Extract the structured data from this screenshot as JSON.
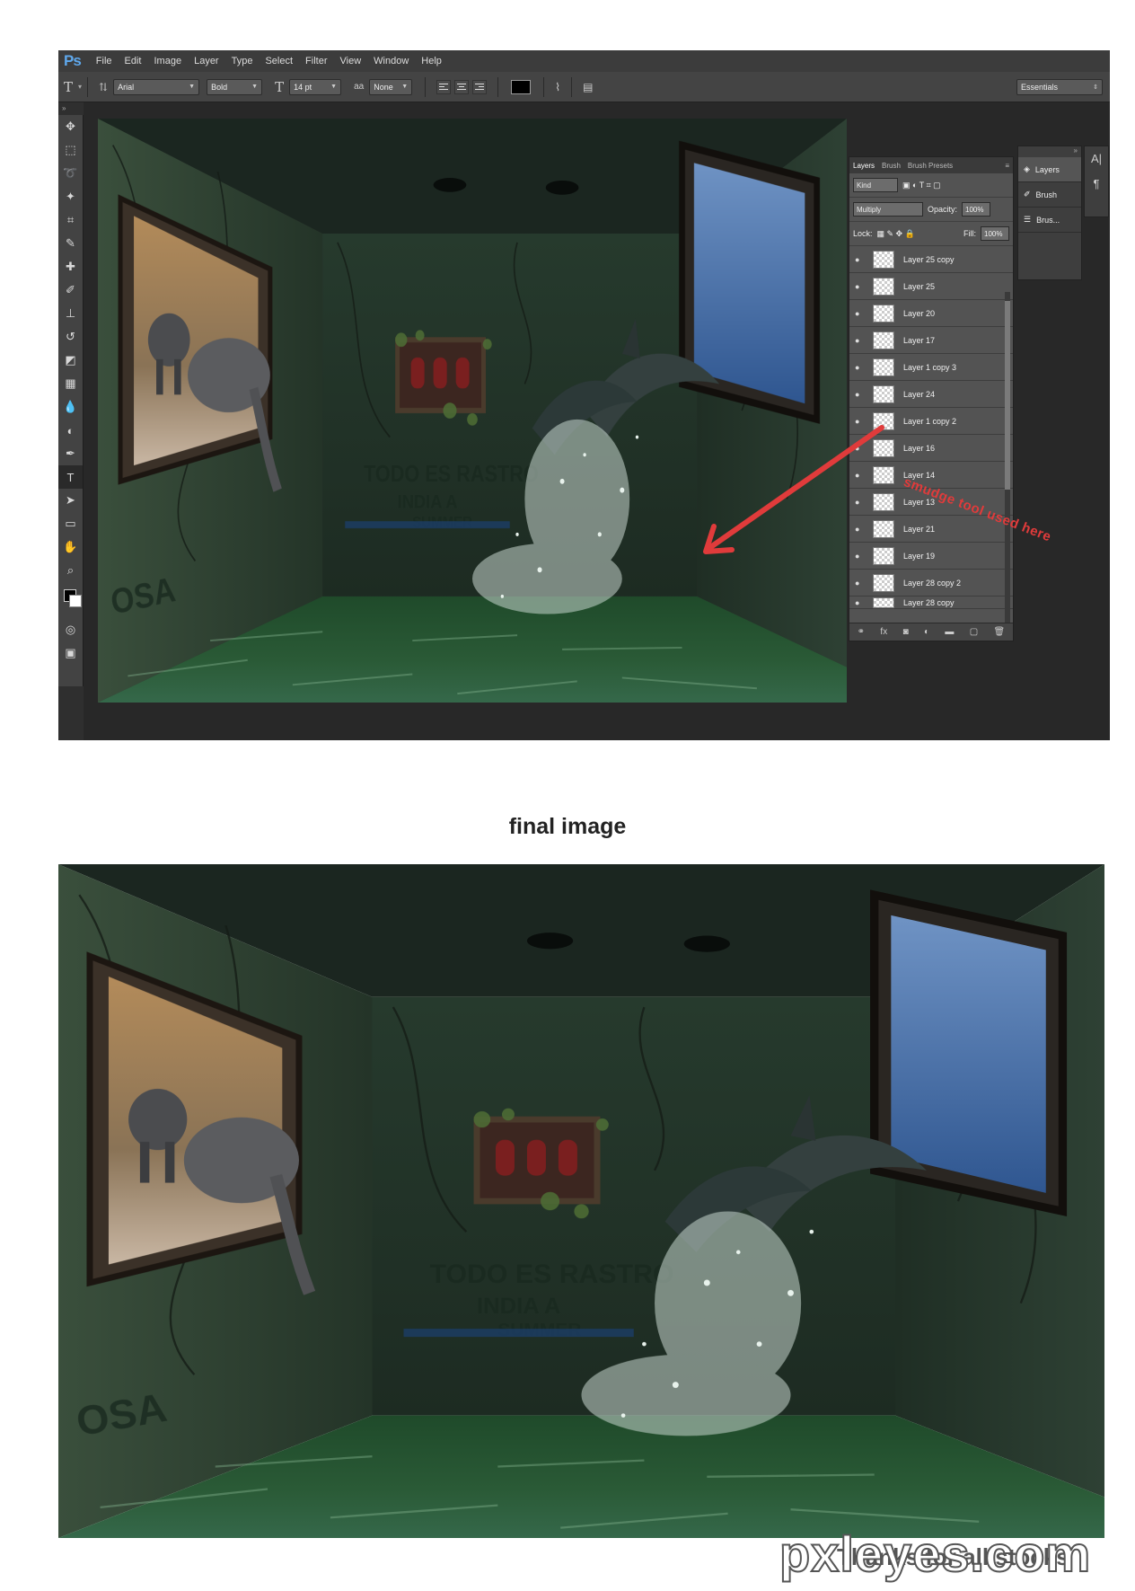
{
  "app": {
    "logo": "Ps",
    "menu": [
      "File",
      "Edit",
      "Image",
      "Layer",
      "Type",
      "Select",
      "Filter",
      "View",
      "Window",
      "Help"
    ]
  },
  "options_bar": {
    "type_icon": "T",
    "font_family": "Arial",
    "font_style": "Bold",
    "font_size": "14 pt",
    "antialias_icon": "aa",
    "antialias": "None",
    "text_color": "#000000",
    "workspace": "Essentials"
  },
  "tools": [
    "move-icon",
    "marquee-icon",
    "lasso-icon",
    "magic-wand-icon",
    "crop-icon",
    "eyedropper-icon",
    "healing-icon",
    "brush-icon",
    "stamp-icon",
    "history-brush-icon",
    "eraser-icon",
    "gradient-icon",
    "blur-icon",
    "dodge-icon",
    "pen-icon",
    "type-icon",
    "path-select-icon",
    "shape-icon",
    "hand-icon",
    "zoom-icon"
  ],
  "layers_panel": {
    "tabs": [
      "Layers",
      "Brush",
      "Brush Presets"
    ],
    "kind": "Kind",
    "blend_mode": "Multiply",
    "opacity_label": "Opacity:",
    "opacity": "100%",
    "lock_label": "Lock:",
    "fill_label": "Fill:",
    "fill": "100%",
    "layers": [
      "Layer 25 copy",
      "Layer 25",
      "Layer 20",
      "Layer 17",
      "Layer 1 copy 3",
      "Layer 24",
      "Layer 1 copy 2",
      "Layer 16",
      "Layer 14",
      "Layer 13",
      "Layer 21",
      "Layer 19",
      "Layer 28 copy 2",
      "Layer 28 copy"
    ]
  },
  "dock": {
    "items": [
      {
        "label": "Layers",
        "icon": "layers-icon"
      },
      {
        "label": "Brush",
        "icon": "brush-icon"
      },
      {
        "label": "Brus...",
        "icon": "brush-presets-icon"
      }
    ],
    "side_icons": [
      "character-icon",
      "paragraph-icon"
    ]
  },
  "annotation": "smudge tool used here",
  "annotation_color": "#e03b3b",
  "final_title": "final image",
  "thanks": "Thanks for all stocks",
  "watermark": "pxleyes.com"
}
